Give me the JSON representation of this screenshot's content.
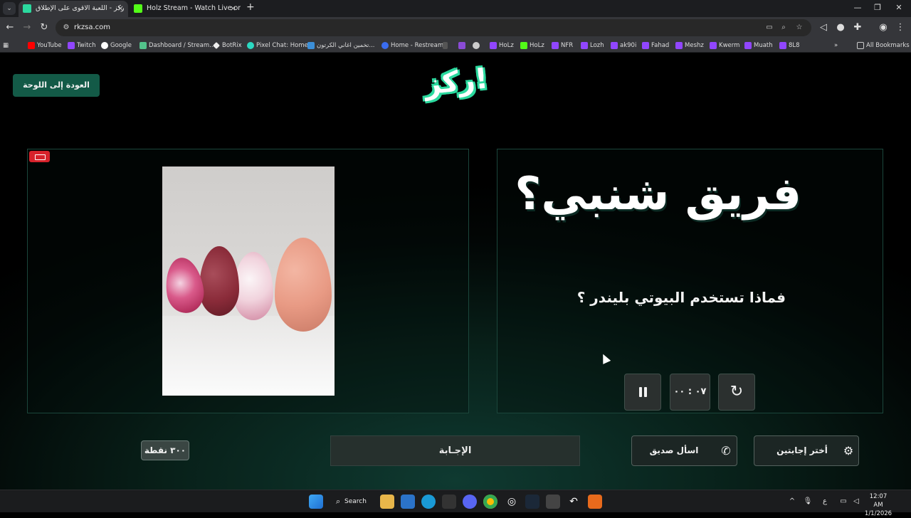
{
  "browser": {
    "tabs": [
      {
        "title": "ركز - اللعبة الاقوى على الإطلاق",
        "close": "×",
        "active": true
      },
      {
        "title": "Holz Stream - Watch Live on Ki",
        "close": "×",
        "active": false
      }
    ],
    "new_tab_label": "+",
    "url": "rkzsa.com",
    "window_controls": {
      "minimize": "—",
      "restore": "❐",
      "close": "✕"
    },
    "bookmarks": [
      "YouTube",
      "Twitch",
      "Google",
      "Dashboard / Stream...",
      "BotRix",
      "Pixel Chat: Home",
      "تخمين اغاني الكرتون...",
      "Home - Restream",
      "HoLz",
      "HoLz",
      "NFR",
      "Lozh",
      "ak90i",
      "Fahad",
      "Meshz",
      "Kwerm",
      "Muath",
      "8L8"
    ],
    "all_bookmarks_label": "All Bookmarks"
  },
  "page": {
    "back_button": "العودة إلى اللوحة",
    "logo_text": "ركز!",
    "category_title": "فريق شنبي؟",
    "question": "فماذا تستخدم البيوتي بليندر ؟",
    "timer": "٠٧ : ٠٠",
    "points": "٣٠٠ نقطة",
    "answer_button": "الإجـابة",
    "ask_friend_button": "اسأل صديق",
    "pick_two_button": "أختر إجابتين",
    "colors": {
      "accent": "#135a47",
      "logo_outline": "#2bd99e",
      "background_dark": "#020605",
      "recording_badge": "#d7222b"
    }
  },
  "taskbar": {
    "search_label": "Search",
    "language": "ع",
    "time": "12:07 AM",
    "date": "1/1/2026"
  }
}
